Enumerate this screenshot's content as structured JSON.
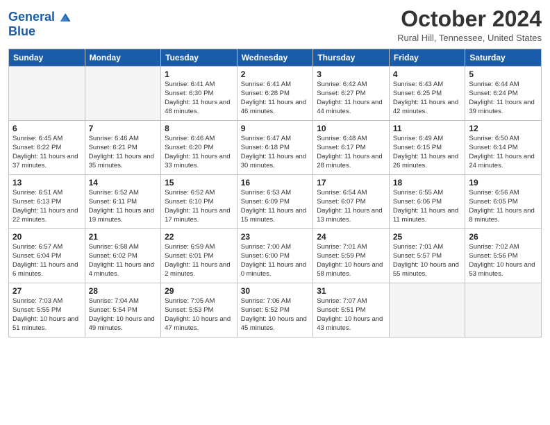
{
  "header": {
    "logo_line1": "General",
    "logo_line2": "Blue",
    "title": "October 2024",
    "location": "Rural Hill, Tennessee, United States"
  },
  "weekdays": [
    "Sunday",
    "Monday",
    "Tuesday",
    "Wednesday",
    "Thursday",
    "Friday",
    "Saturday"
  ],
  "weeks": [
    [
      {
        "day": "",
        "empty": true
      },
      {
        "day": "",
        "empty": true
      },
      {
        "day": "1",
        "sunrise": "6:41 AM",
        "sunset": "6:30 PM",
        "daylight": "11 hours and 48 minutes."
      },
      {
        "day": "2",
        "sunrise": "6:41 AM",
        "sunset": "6:28 PM",
        "daylight": "11 hours and 46 minutes."
      },
      {
        "day": "3",
        "sunrise": "6:42 AM",
        "sunset": "6:27 PM",
        "daylight": "11 hours and 44 minutes."
      },
      {
        "day": "4",
        "sunrise": "6:43 AM",
        "sunset": "6:25 PM",
        "daylight": "11 hours and 42 minutes."
      },
      {
        "day": "5",
        "sunrise": "6:44 AM",
        "sunset": "6:24 PM",
        "daylight": "11 hours and 39 minutes."
      }
    ],
    [
      {
        "day": "6",
        "sunrise": "6:45 AM",
        "sunset": "6:22 PM",
        "daylight": "11 hours and 37 minutes."
      },
      {
        "day": "7",
        "sunrise": "6:46 AM",
        "sunset": "6:21 PM",
        "daylight": "11 hours and 35 minutes."
      },
      {
        "day": "8",
        "sunrise": "6:46 AM",
        "sunset": "6:20 PM",
        "daylight": "11 hours and 33 minutes."
      },
      {
        "day": "9",
        "sunrise": "6:47 AM",
        "sunset": "6:18 PM",
        "daylight": "11 hours and 30 minutes."
      },
      {
        "day": "10",
        "sunrise": "6:48 AM",
        "sunset": "6:17 PM",
        "daylight": "11 hours and 28 minutes."
      },
      {
        "day": "11",
        "sunrise": "6:49 AM",
        "sunset": "6:15 PM",
        "daylight": "11 hours and 26 minutes."
      },
      {
        "day": "12",
        "sunrise": "6:50 AM",
        "sunset": "6:14 PM",
        "daylight": "11 hours and 24 minutes."
      }
    ],
    [
      {
        "day": "13",
        "sunrise": "6:51 AM",
        "sunset": "6:13 PM",
        "daylight": "11 hours and 22 minutes."
      },
      {
        "day": "14",
        "sunrise": "6:52 AM",
        "sunset": "6:11 PM",
        "daylight": "11 hours and 19 minutes."
      },
      {
        "day": "15",
        "sunrise": "6:52 AM",
        "sunset": "6:10 PM",
        "daylight": "11 hours and 17 minutes."
      },
      {
        "day": "16",
        "sunrise": "6:53 AM",
        "sunset": "6:09 PM",
        "daylight": "11 hours and 15 minutes."
      },
      {
        "day": "17",
        "sunrise": "6:54 AM",
        "sunset": "6:07 PM",
        "daylight": "11 hours and 13 minutes."
      },
      {
        "day": "18",
        "sunrise": "6:55 AM",
        "sunset": "6:06 PM",
        "daylight": "11 hours and 11 minutes."
      },
      {
        "day": "19",
        "sunrise": "6:56 AM",
        "sunset": "6:05 PM",
        "daylight": "11 hours and 8 minutes."
      }
    ],
    [
      {
        "day": "20",
        "sunrise": "6:57 AM",
        "sunset": "6:04 PM",
        "daylight": "11 hours and 6 minutes."
      },
      {
        "day": "21",
        "sunrise": "6:58 AM",
        "sunset": "6:02 PM",
        "daylight": "11 hours and 4 minutes."
      },
      {
        "day": "22",
        "sunrise": "6:59 AM",
        "sunset": "6:01 PM",
        "daylight": "11 hours and 2 minutes."
      },
      {
        "day": "23",
        "sunrise": "7:00 AM",
        "sunset": "6:00 PM",
        "daylight": "11 hours and 0 minutes."
      },
      {
        "day": "24",
        "sunrise": "7:01 AM",
        "sunset": "5:59 PM",
        "daylight": "10 hours and 58 minutes."
      },
      {
        "day": "25",
        "sunrise": "7:01 AM",
        "sunset": "5:57 PM",
        "daylight": "10 hours and 55 minutes."
      },
      {
        "day": "26",
        "sunrise": "7:02 AM",
        "sunset": "5:56 PM",
        "daylight": "10 hours and 53 minutes."
      }
    ],
    [
      {
        "day": "27",
        "sunrise": "7:03 AM",
        "sunset": "5:55 PM",
        "daylight": "10 hours and 51 minutes."
      },
      {
        "day": "28",
        "sunrise": "7:04 AM",
        "sunset": "5:54 PM",
        "daylight": "10 hours and 49 minutes."
      },
      {
        "day": "29",
        "sunrise": "7:05 AM",
        "sunset": "5:53 PM",
        "daylight": "10 hours and 47 minutes."
      },
      {
        "day": "30",
        "sunrise": "7:06 AM",
        "sunset": "5:52 PM",
        "daylight": "10 hours and 45 minutes."
      },
      {
        "day": "31",
        "sunrise": "7:07 AM",
        "sunset": "5:51 PM",
        "daylight": "10 hours and 43 minutes."
      },
      {
        "day": "",
        "empty": true
      },
      {
        "day": "",
        "empty": true
      }
    ]
  ]
}
